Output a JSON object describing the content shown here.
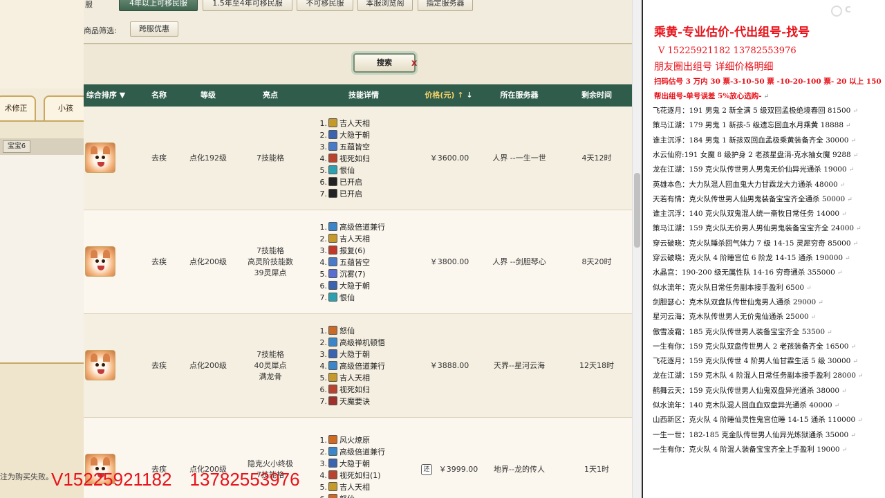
{
  "left_panel": {
    "tab1": "术修正",
    "tab2": "小孩",
    "subtab": "宝宝6",
    "footnote": "注为购买失败。"
  },
  "filters": {
    "buttons": [
      {
        "label": "4年以上可移民服",
        "active": true
      },
      {
        "label": "1.5年至4年可移民服",
        "active": false
      },
      {
        "label": "不可移民服",
        "active": false
      },
      {
        "label": "本服浏览阁",
        "active": false
      },
      {
        "label": "指定服务器",
        "active": false
      }
    ],
    "label_partial": "服",
    "goods_filter_label": "商品筛选:",
    "goods_filter_button": "跨服优惠"
  },
  "search": {
    "button_label": "搜索",
    "clear_icon": "x"
  },
  "table": {
    "headers": {
      "sort": "综合排序",
      "name": "名称",
      "level": "等级",
      "highlights": "亮点",
      "skills": "技能详情",
      "price": "价格(元)",
      "server": "所在服务器",
      "time_left": "剩余时间"
    },
    "rows": [
      {
        "name": "去疾",
        "level": "点化192级",
        "highlights": [
          "7技能格"
        ],
        "skills": [
          {
            "n": "1.",
            "name": "吉人天相",
            "color": "#c69a2a"
          },
          {
            "n": "2.",
            "name": "大隐于朝",
            "color": "#3a64b0"
          },
          {
            "n": "3.",
            "name": "五蕴皆空",
            "color": "#4a7bc8"
          },
          {
            "n": "4.",
            "name": "视死如归",
            "color": "#b8432e"
          },
          {
            "n": "5.",
            "name": "恨仙",
            "color": "#2c9fb0"
          },
          {
            "n": "6.",
            "name": "已开启",
            "color": "#222222"
          },
          {
            "n": "7.",
            "name": "已开启",
            "color": "#222222"
          }
        ],
        "price": "￥3600.00",
        "server": "人界 --一生一世",
        "time_left": "4天12时",
        "badge": ""
      },
      {
        "name": "去疾",
        "level": "点化200级",
        "highlights": [
          "7技能格",
          "高灵阶技能数",
          "39灵犀点"
        ],
        "skills": [
          {
            "n": "1.",
            "name": "高级倍道兼行",
            "color": "#3a86c8"
          },
          {
            "n": "2.",
            "name": "吉人天相",
            "color": "#c69a2a"
          },
          {
            "n": "3.",
            "name": "报复(6)",
            "color": "#c0392b"
          },
          {
            "n": "4.",
            "name": "五蕴皆空",
            "color": "#4a7bc8"
          },
          {
            "n": "5.",
            "name": "沉雾(7)",
            "color": "#5a6fd0"
          },
          {
            "n": "6.",
            "name": "大隐于朝",
            "color": "#3a64b0"
          },
          {
            "n": "7.",
            "name": "恨仙",
            "color": "#2c9fb0"
          }
        ],
        "price": "￥3800.00",
        "server": "人界 --剑胆琴心",
        "time_left": "8天20时",
        "badge": ""
      },
      {
        "name": "去疾",
        "level": "点化200级",
        "highlights": [
          "7技能格",
          "40灵犀点",
          "满龙骨"
        ],
        "skills": [
          {
            "n": "1.",
            "name": "怒仙",
            "color": "#c86a2a"
          },
          {
            "n": "2.",
            "name": "高级禅机顿悟",
            "color": "#3a86c8"
          },
          {
            "n": "3.",
            "name": "大隐于朝",
            "color": "#3a64b0"
          },
          {
            "n": "4.",
            "name": "高级倍道兼行",
            "color": "#3a86c8"
          },
          {
            "n": "5.",
            "name": "吉人天相",
            "color": "#c69a2a"
          },
          {
            "n": "6.",
            "name": "视死如归",
            "color": "#b8432e"
          },
          {
            "n": "7.",
            "name": "天魔要诀",
            "color": "#a0302a"
          }
        ],
        "price": "￥3888.00",
        "server": "天界--星河云海",
        "time_left": "12天18时",
        "badge": ""
      },
      {
        "name": "去疾",
        "level": "点化200级",
        "highlights": [
          "隐克火小终极",
          "7技能格"
        ],
        "skills": [
          {
            "n": "1.",
            "name": "风火燎原",
            "color": "#d06a20"
          },
          {
            "n": "2.",
            "name": "高级倍道兼行",
            "color": "#3a86c8"
          },
          {
            "n": "3.",
            "name": "大隐于朝",
            "color": "#3a64b0"
          },
          {
            "n": "4.",
            "name": "视死如归(1)",
            "color": "#b8432e"
          },
          {
            "n": "5.",
            "name": "吉人天相",
            "color": "#c69a2a"
          },
          {
            "n": "6.",
            "name": "怒仙",
            "color": "#c86a2a"
          }
        ],
        "price": "￥3999.00",
        "server": "地界--龙的传人",
        "time_left": "1天1时",
        "badge": "还"
      }
    ]
  },
  "overlay_numbers": [
    "V15225921182",
    "13782553976"
  ],
  "doc": {
    "title": "乘黄-专业估价-代出组号-找号",
    "phones": "V 15225921182   13782553976",
    "subtitle": "朋友圈出组号    详细价格明细",
    "pricing": "扫码估号 3 万内 30 票-3-10-50 票  -10-20-100 票- 20 以上 150",
    "help": "帮出组号-单号误差 5%放心选购-",
    "listings": [
      "飞花逐月：191 男鬼 2 新全满 5 级双回孟极绝境春回 81500",
      "策马江湖：179 男鬼 1 新孩-5 级遗忘回血水月乘黄 18888",
      "谁主沉浮：184 男鬼 1 新孩双回血孟极乘黄装备齐全 30000",
      "水云仙府:191 女魔 8 级护身 2 老孩星盘涓-克水抽女魔 9288",
      "龙在江湖：159 克火队传世男人男鬼无价仙异光通杀 19000",
      "英雄本色：大力队混人回血鬼大力甘霖龙大力通杀 48000",
      "天若有情：克火队传世男人仙男鬼装备宝宝齐全通杀 50000",
      "谁主沉浮：140 克火队双鬼混人统一斋牧日常任务 14000",
      "策马江湖：159 克火队无价男人男仙男鬼装备宝宝齐全 24000",
      "穿云破晓：克火队睡杀回气体力 7 级 14-15 灵犀穷奇 85000",
      "穿云破晓：克火队 4 阶睡宫位 6 阶龙 14-15 通杀 190000",
      "水晶宫：190-200 级无属性队 14-16 穷奇通杀 355000",
      "似水流年：克火队日常任务副本接手盈利 6500",
      "剑胆瑟心：克木队双盘队传世仙鬼男人通杀 29000",
      "星河云海：克木队传世男人无价鬼仙通杀 25000",
      "傲雪凌霜：185 克火队传世男人装备宝宝齐全 53500",
      "一生有你：159 克火队双盘传世男人 2 老孩装备齐全 16500",
      "飞花逐月：159 克火队传世 4 阶男人仙甘霖生活 5 级 30000",
      "龙在江湖：159 克木队 4 阶混人日常任务副本接手盈利 28000",
      "鹤舞云天：159 克火队传世男人仙鬼双盘异光通杀 38000",
      "似水流年：140 克木队混人回血血双盘异光通杀 40000",
      "山西新区：克火队 4 阶睡仙灵性鬼宫位睡 14-15 通杀 110000",
      "一生一世：182-185 克金队传世男人仙异光炼狱通杀 35000",
      "一生有你：克火队 4 阶混人装备宝宝齐全上手盈利 19000"
    ],
    "watermark": "C"
  }
}
